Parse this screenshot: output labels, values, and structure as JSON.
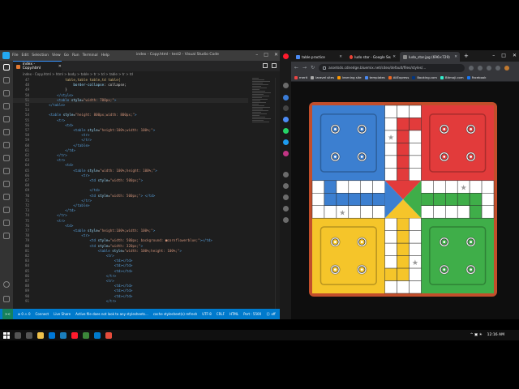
{
  "vscode": {
    "window_title": "index - Copy.html - test2 - Visual Studio Code",
    "menu": [
      "File",
      "Edit",
      "Selection",
      "View",
      "Go",
      "Run",
      "Terminal",
      "Help"
    ],
    "tab_label": "index - Copy.html",
    "breadcrumb": "index - Copy.html > html > body > table > tr > td > table > tr > td",
    "code_lines": [
      {
        "n": "47",
        "html": "            <span class='t-css'>table,table table,td table{</span>"
      },
      {
        "n": "48",
        "html": "                <span class='t-attr'>border-collapse</span><span class='t-txt'>: collapse;</span>"
      },
      {
        "n": "49",
        "html": "            <span class='t-txt'>}</span>"
      },
      {
        "n": "50",
        "html": "        <span class='t-tag'>&lt;/style&gt;</span>"
      },
      {
        "n": "51",
        "html": "        <span class='t-tag'>&lt;table</span> <span class='t-attr'>style</span><span class='t-txt'>=</span><span class='t-str'>\"width: 700px;\"</span><span class='t-tag'>&gt;</span>",
        "hl": true
      },
      {
        "n": "52",
        "html": "    <span class='t-tag'>&lt;/table&gt;</span>"
      },
      {
        "n": "53",
        "html": ""
      },
      {
        "n": "54",
        "html": "    <span class='t-tag'>&lt;table</span> <span class='t-attr'>style</span><span class='t-txt'>=</span><span class='t-str'>\"height: 800px;width: 800px;\"</span><span class='t-tag'>&gt;</span>"
      },
      {
        "n": "55",
        "html": "        <span class='t-tag'>&lt;tr&gt;</span>"
      },
      {
        "n": "56",
        "html": "            <span class='t-tag'>&lt;td&gt;</span>"
      },
      {
        "n": "57",
        "html": "                <span class='t-tag'>&lt;table</span> <span class='t-attr'>style</span><span class='t-txt'>=</span><span class='t-str'>\"height:100%;width: 100%;\"</span><span class='t-tag'>&gt;</span>"
      },
      {
        "n": "58",
        "html": "                    <span class='t-tag'>&lt;tr&gt;</span>"
      },
      {
        "n": "59",
        "html": "                    <span class='t-tag'>&lt;/tr&gt;</span>"
      },
      {
        "n": "60",
        "html": "                <span class='t-tag'>&lt;/table&gt;</span>"
      },
      {
        "n": "61",
        "html": "            <span class='t-tag'>&lt;/td&gt;</span>"
      },
      {
        "n": "62",
        "html": "        <span class='t-tag'>&lt;/tr&gt;</span>"
      },
      {
        "n": "63",
        "html": "        <span class='t-tag'>&lt;tr&gt;</span>"
      },
      {
        "n": "64",
        "html": "            <span class='t-tag'>&lt;td&gt;</span>"
      },
      {
        "n": "65",
        "html": "                <span class='t-tag'>&lt;table</span> <span class='t-attr'>style</span><span class='t-txt'>=</span><span class='t-str'>\"width: 100%;height: 100%;\"</span><span class='t-tag'>&gt;</span>"
      },
      {
        "n": "66",
        "html": "                    <span class='t-tag'>&lt;tr&gt;</span>"
      },
      {
        "n": "67",
        "html": "                        <span class='t-tag'>&lt;td</span> <span class='t-attr'>style</span><span class='t-txt'>=</span><span class='t-str'>\"width: 500px;\"</span><span class='t-tag'>&gt;</span>"
      },
      {
        "n": "68",
        "html": ""
      },
      {
        "n": "69",
        "html": "                        <span class='t-tag'>&lt;/td&gt;</span>"
      },
      {
        "n": "70",
        "html": "                        <span class='t-tag'>&lt;td</span> <span class='t-attr'>style</span><span class='t-txt'>=</span><span class='t-str'>\"width: 500px;\"</span><span class='t-tag'>&gt;</span> <span class='t-tag'>&lt;/td&gt;</span>"
      },
      {
        "n": "71",
        "html": "                    <span class='t-tag'>&lt;/tr&gt;</span>"
      },
      {
        "n": "72",
        "html": "                <span class='t-tag'>&lt;/table&gt;</span>"
      },
      {
        "n": "73",
        "html": "            <span class='t-tag'>&lt;/td&gt;</span>"
      },
      {
        "n": "74",
        "html": "        <span class='t-tag'>&lt;/tr&gt;</span>"
      },
      {
        "n": "75",
        "html": "        <span class='t-tag'>&lt;tr&gt;</span>"
      },
      {
        "n": "76",
        "html": "            <span class='t-tag'>&lt;td&gt;</span>"
      },
      {
        "n": "77",
        "html": "                <span class='t-tag'>&lt;table</span> <span class='t-attr'>style</span><span class='t-txt'>=</span><span class='t-str'>\"height:100%;width: 100%;\"</span><span class='t-tag'>&gt;</span>"
      },
      {
        "n": "78",
        "html": "                    <span class='t-tag'>&lt;tr&gt;</span>"
      },
      {
        "n": "79",
        "html": "                        <span class='t-tag'>&lt;td</span> <span class='t-attr'>style</span><span class='t-txt'>=</span><span class='t-str'>\"width: 500px; background: ■cornflowerblue;\"</span><span class='t-tag'>&gt;&lt;/td&gt;</span>"
      },
      {
        "n": "80",
        "html": "                        <span class='t-tag'>&lt;td</span> <span class='t-attr'>style</span><span class='t-txt'>=</span><span class='t-str'>\"width: 320px;\"</span><span class='t-tag'>&gt;</span>"
      },
      {
        "n": "81",
        "html": "                            <span class='t-tag'>&lt;table</span> <span class='t-attr'>style</span><span class='t-txt'>=</span><span class='t-str'>\"width: 100%;height: 100%;\"</span><span class='t-tag'>&gt;</span>"
      },
      {
        "n": "82",
        "html": "                                <span class='t-tag'>&lt;tr&gt;</span>"
      },
      {
        "n": "83",
        "html": "                                    <span class='t-tag'>&lt;td&gt;&lt;/td&gt;</span>"
      },
      {
        "n": "84",
        "html": "                                    <span class='t-tag'>&lt;td&gt;&lt;/td&gt;</span>"
      },
      {
        "n": "85",
        "html": "                                    <span class='t-tag'>&lt;td&gt;&lt;/td&gt;</span>"
      },
      {
        "n": "86",
        "html": "                                <span class='t-tag'>&lt;/tr&gt;</span>"
      },
      {
        "n": "87",
        "html": "                                <span class='t-tag'>&lt;tr&gt;</span>"
      },
      {
        "n": "88",
        "html": "                                    <span class='t-tag'>&lt;td&gt;&lt;/td&gt;</span>"
      },
      {
        "n": "89",
        "html": "                                    <span class='t-tag'>&lt;td&gt;&lt;/td&gt;</span>"
      },
      {
        "n": "90",
        "html": "                                    <span class='t-tag'>&lt;td&gt;&lt;/td&gt;</span>"
      },
      {
        "n": "91",
        "html": "                                <span class='t-tag'>&lt;/tr&gt;</span>"
      }
    ],
    "status": {
      "remote": "><",
      "errors": "⊗ 0 ⚠ 0",
      "connect": "Connect",
      "live_share": "Live Share",
      "message": "Active file does not look to any stylesheets...",
      "cache": "cache stylesheet(s) refresh",
      "encoding": "UTF-8",
      "eol": "CRLF",
      "language": "HTML",
      "port": "Port : 5500",
      "golive": "{} off"
    }
  },
  "browser": {
    "tabs": [
      {
        "label": "table practice",
        "active": false
      },
      {
        "label": "ludo star - Google Search",
        "active": false
      },
      {
        "label": "ludo_star.jpg (696×729)",
        "active": true
      }
    ],
    "url": "assetsds.cdnedge.bluemix.net/sites/default/files/styles/...",
    "bookmarks": [
      "merit",
      "laravel sites",
      "learning site",
      "templates",
      "AliExpress",
      "Booking.com",
      "Bitmoji.com",
      "Facebook"
    ]
  },
  "ludo_colors": {
    "board_frame": "#c24e2b",
    "red": "#e23b3b",
    "green": "#3fae49",
    "yellow": "#f5c52a",
    "blue": "#3c7fd0",
    "white": "#ffffff",
    "grid": "#2b2b2b"
  },
  "taskbar": {
    "time": "12:16 AM"
  }
}
